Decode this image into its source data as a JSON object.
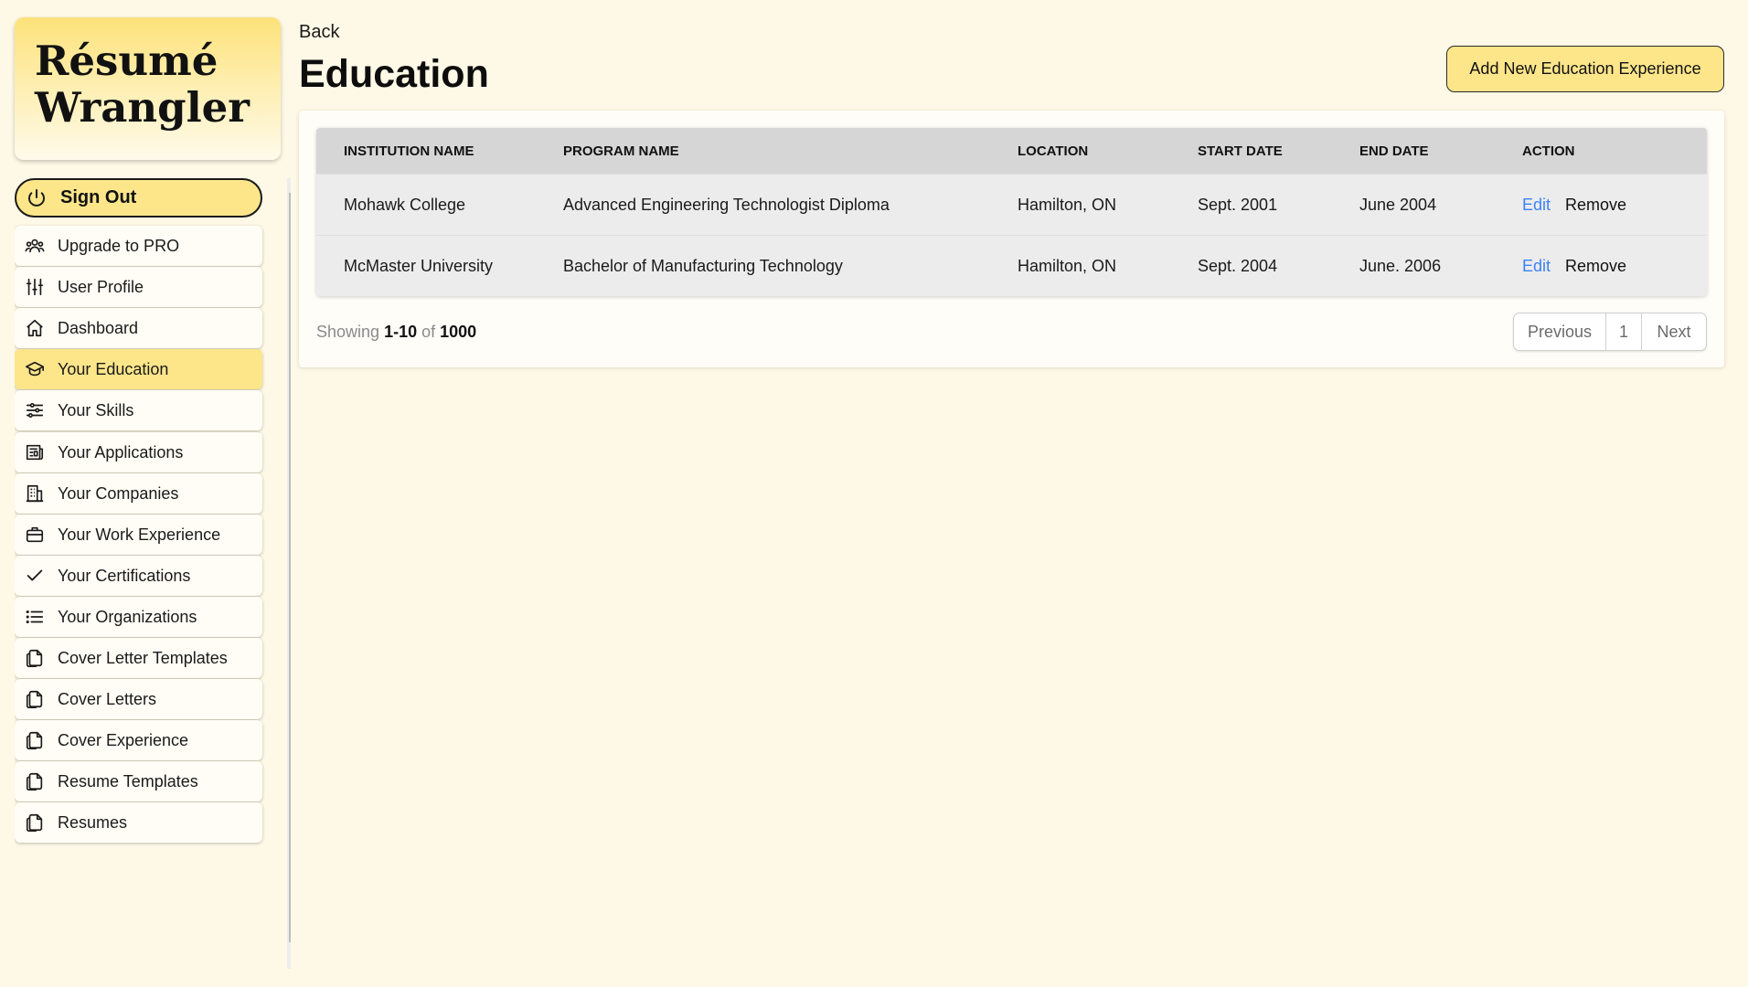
{
  "app": {
    "logo_line1": "Résumé",
    "logo_line2": "Wrangler"
  },
  "sidebar": {
    "sign_out": {
      "label": "Sign Out",
      "icon": "power-icon"
    },
    "items": [
      {
        "label": "Upgrade to PRO",
        "icon": "users-icon"
      },
      {
        "label": "User Profile",
        "icon": "sliders-vertical-icon"
      },
      {
        "label": "Dashboard",
        "icon": "home-icon"
      },
      {
        "label": "Your Education",
        "icon": "graduation-cap-icon",
        "active": true
      },
      {
        "label": "Your Skills",
        "icon": "sliders-horizontal-icon"
      },
      {
        "label": "Your Applications",
        "icon": "newspaper-icon"
      },
      {
        "label": "Your Companies",
        "icon": "building-icon"
      },
      {
        "label": "Your Work Experience",
        "icon": "briefcase-icon"
      },
      {
        "label": "Your Certifications",
        "icon": "check-icon"
      },
      {
        "label": "Your Organizations",
        "icon": "list-icon"
      },
      {
        "label": "Cover Letter Templates",
        "icon": "documents-icon"
      },
      {
        "label": "Cover Letters",
        "icon": "documents-icon"
      },
      {
        "label": "Cover Experience",
        "icon": "documents-icon"
      },
      {
        "label": "Resume Templates",
        "icon": "documents-icon"
      },
      {
        "label": "Resumes",
        "icon": "documents-icon"
      }
    ]
  },
  "header": {
    "back_label": "Back",
    "title": "Education",
    "add_button_label": "Add New Education Experience"
  },
  "table": {
    "columns": [
      "INSTITUTION NAME",
      "PROGRAM NAME",
      "LOCATION",
      "START DATE",
      "END DATE",
      "ACTION"
    ],
    "rows": [
      {
        "institution": "Mohawk College",
        "program": "Advanced Engineering Technologist Diploma",
        "location": "Hamilton, ON",
        "start": "Sept. 2001",
        "end": "June 2004"
      },
      {
        "institution": "McMaster University",
        "program": "Bachelor of Manufacturing Technology",
        "location": "Hamilton, ON",
        "start": "Sept. 2004",
        "end": "June. 2006"
      }
    ],
    "edit_label": "Edit",
    "remove_label": "Remove"
  },
  "pagination": {
    "showing_prefix": "Showing",
    "range": "1-10",
    "of_label": "of",
    "total": "1000",
    "previous_label": "Previous",
    "current_page": "1",
    "next_label": "Next"
  },
  "colors": {
    "background": "#fef8e6",
    "accent": "#fde68a",
    "link": "#3b82f6"
  }
}
